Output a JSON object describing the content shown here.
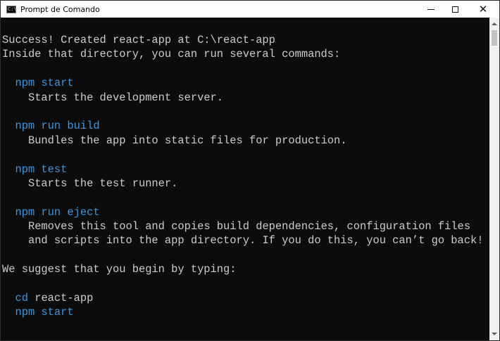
{
  "window": {
    "title": "Prompt de Comando",
    "icon": "console-icon",
    "icon_glyph": "C:\\",
    "controls": {
      "minimize": "minimize-icon",
      "maximize": "maximize-icon",
      "close": "✕"
    }
  },
  "console": {
    "colors": {
      "background": "#0c0c0c",
      "text": "#cccccc",
      "command": "#3a96dd"
    },
    "lines": [
      {
        "indent": "",
        "text": "Success! Created react-app at C:\\react-app",
        "kind": "plain"
      },
      {
        "indent": "",
        "text": "Inside that directory, you can run several commands:",
        "kind": "plain"
      },
      {
        "indent": "",
        "text": "",
        "kind": "plain"
      },
      {
        "indent": "  ",
        "text": "npm start",
        "kind": "cmd"
      },
      {
        "indent": "    ",
        "text": "Starts the development server.",
        "kind": "plain"
      },
      {
        "indent": "",
        "text": "",
        "kind": "plain"
      },
      {
        "indent": "  ",
        "text": "npm run build",
        "kind": "cmd"
      },
      {
        "indent": "    ",
        "text": "Bundles the app into static files for production.",
        "kind": "plain"
      },
      {
        "indent": "",
        "text": "",
        "kind": "plain"
      },
      {
        "indent": "  ",
        "text": "npm test",
        "kind": "cmd"
      },
      {
        "indent": "    ",
        "text": "Starts the test runner.",
        "kind": "plain"
      },
      {
        "indent": "",
        "text": "",
        "kind": "plain"
      },
      {
        "indent": "  ",
        "text": "npm run eject",
        "kind": "cmd"
      },
      {
        "indent": "    ",
        "text": "Removes this tool and copies build dependencies, configuration files",
        "kind": "plain"
      },
      {
        "indent": "    ",
        "text": "and scripts into the app directory. If you do this, you can’t go back!",
        "kind": "plain"
      },
      {
        "indent": "",
        "text": "",
        "kind": "plain"
      },
      {
        "indent": "",
        "text": "We suggest that you begin by typing:",
        "kind": "plain"
      },
      {
        "indent": "",
        "text": "",
        "kind": "plain"
      },
      {
        "indent": "  ",
        "parts": [
          {
            "text": "cd",
            "kind": "cmd"
          },
          {
            "text": " react-app",
            "kind": "plain"
          }
        ]
      },
      {
        "indent": "  ",
        "text": "npm start",
        "kind": "cmd"
      }
    ]
  }
}
